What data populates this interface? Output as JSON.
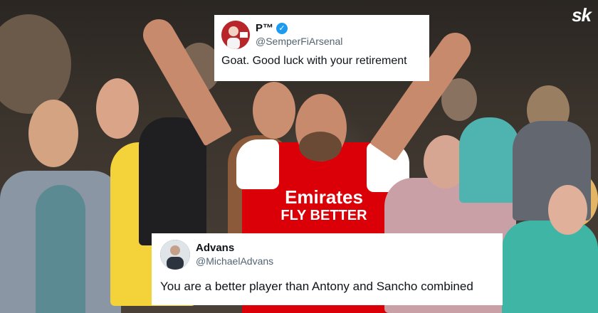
{
  "brand": {
    "logo": "sk"
  },
  "jersey": {
    "sponsor_line1": "Emirates",
    "sponsor_line2": "FLY BETTER"
  },
  "tweets": [
    {
      "name": "P™",
      "handle": "@SemperFiArsenal",
      "verified": true,
      "verified_icon": "✓",
      "text": "Goat. Good luck with your retirement"
    },
    {
      "name": "Advans",
      "handle": "@MichaelAdvans",
      "verified": false,
      "text": "You are a better player than Antony and Sancho combined"
    }
  ],
  "colors": {
    "verified_blue": "#1d9bf0",
    "arsenal_red": "#db0007",
    "arsenal_white": "#ffffff",
    "away_yellow": "#f3d23a"
  }
}
